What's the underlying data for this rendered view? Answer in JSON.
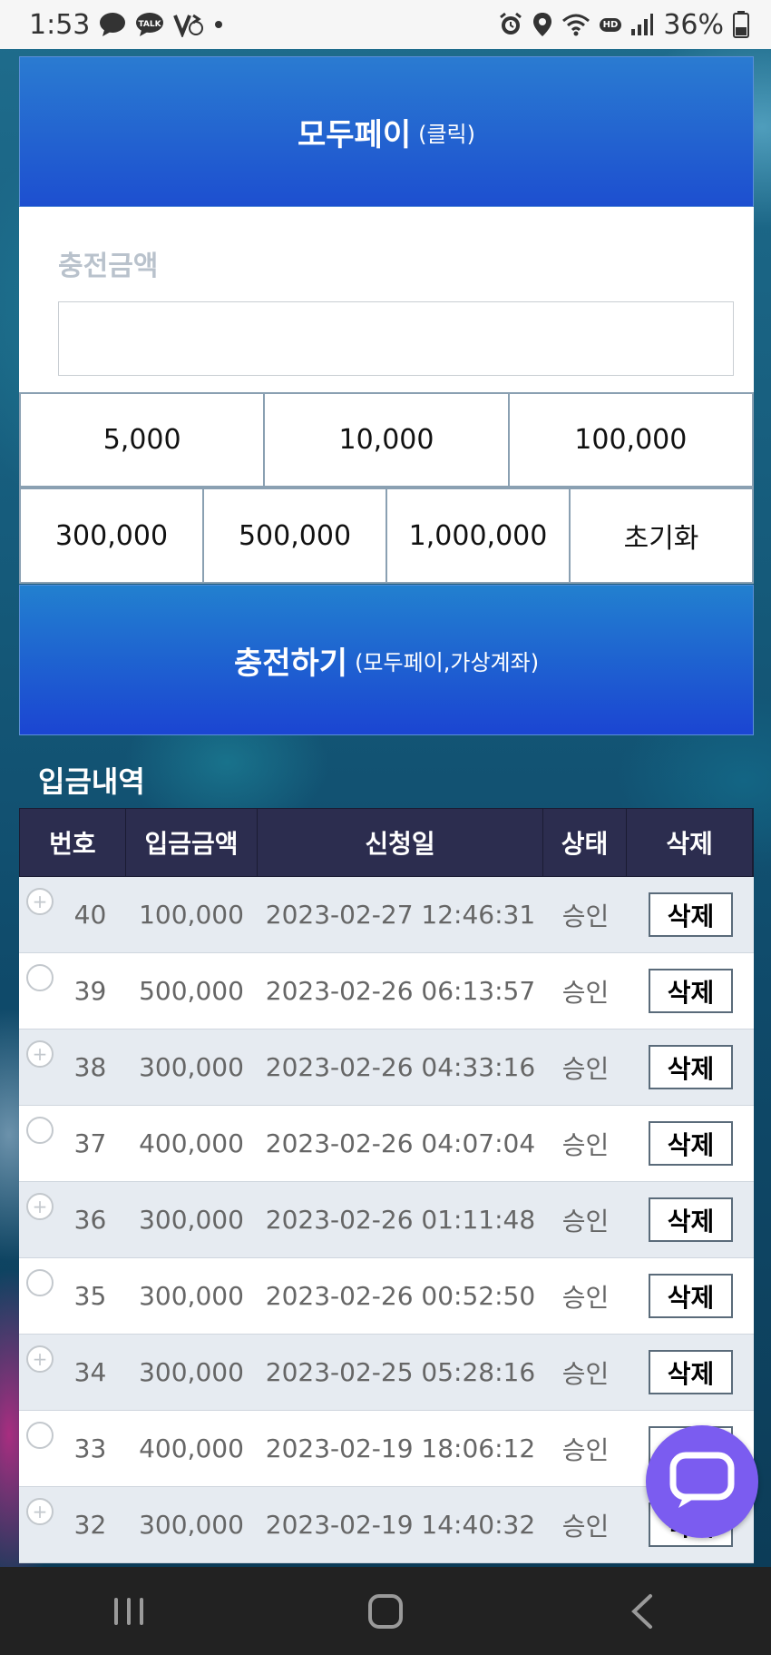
{
  "status_bar": {
    "time": "1:53",
    "battery": "36%",
    "icons": [
      "chat-bubble-icon",
      "kakaotalk-icon",
      "v-sync-icon",
      "dot-icon",
      "alarm-icon",
      "location-icon",
      "wifi-icon",
      "hd-voice-icon",
      "signal-icon",
      "battery-icon"
    ],
    "talk_chip": "TALK",
    "hd_chip": "HD"
  },
  "payment_header": {
    "title": "모두페이",
    "subtitle": "(클릭)"
  },
  "charge_amount": {
    "label": "충전금액",
    "value": "",
    "placeholder": ""
  },
  "amount_buttons": {
    "row1": [
      "5,000",
      "10,000",
      "100,000"
    ],
    "row2": [
      "300,000",
      "500,000",
      "1,000,000"
    ],
    "reset": "초기화"
  },
  "charge_button": {
    "title": "충전하기",
    "subtitle": "(모두페이,가상계좌)"
  },
  "history": {
    "title": "입금내역",
    "columns": [
      "번호",
      "입금금액",
      "신청일",
      "상태",
      "삭제"
    ],
    "rows": [
      {
        "no": "40",
        "amount": "100,000",
        "date": "2023-02-27 12:46:31",
        "status": "승인",
        "delete": "삭제",
        "marker": "+"
      },
      {
        "no": "39",
        "amount": "500,000",
        "date": "2023-02-26 06:13:57",
        "status": "승인",
        "delete": "삭제",
        "marker": ""
      },
      {
        "no": "38",
        "amount": "300,000",
        "date": "2023-02-26 04:33:16",
        "status": "승인",
        "delete": "삭제",
        "marker": "+"
      },
      {
        "no": "37",
        "amount": "400,000",
        "date": "2023-02-26 04:07:04",
        "status": "승인",
        "delete": "삭제",
        "marker": ""
      },
      {
        "no": "36",
        "amount": "300,000",
        "date": "2023-02-26 01:11:48",
        "status": "승인",
        "delete": "삭제",
        "marker": "+"
      },
      {
        "no": "35",
        "amount": "300,000",
        "date": "2023-02-26 00:52:50",
        "status": "승인",
        "delete": "삭제",
        "marker": ""
      },
      {
        "no": "34",
        "amount": "300,000",
        "date": "2023-02-25 05:28:16",
        "status": "승인",
        "delete": "삭제",
        "marker": "+"
      },
      {
        "no": "33",
        "amount": "400,000",
        "date": "2023-02-19 18:06:12",
        "status": "승인",
        "delete": "삭제",
        "marker": ""
      },
      {
        "no": "32",
        "amount": "300,000",
        "date": "2023-02-19 14:40:32",
        "status": "승인",
        "delete": "삭제",
        "marker": "+"
      }
    ]
  },
  "colors": {
    "header_blue": "#1d4fd0",
    "table_header": "#2c2d4f",
    "chat_fab": "#7b5cf0"
  },
  "chat_button": {
    "icon": "chat-bubble-icon"
  },
  "nav_bar": {
    "icons": [
      "recent-apps-icon",
      "home-icon",
      "back-icon"
    ]
  }
}
